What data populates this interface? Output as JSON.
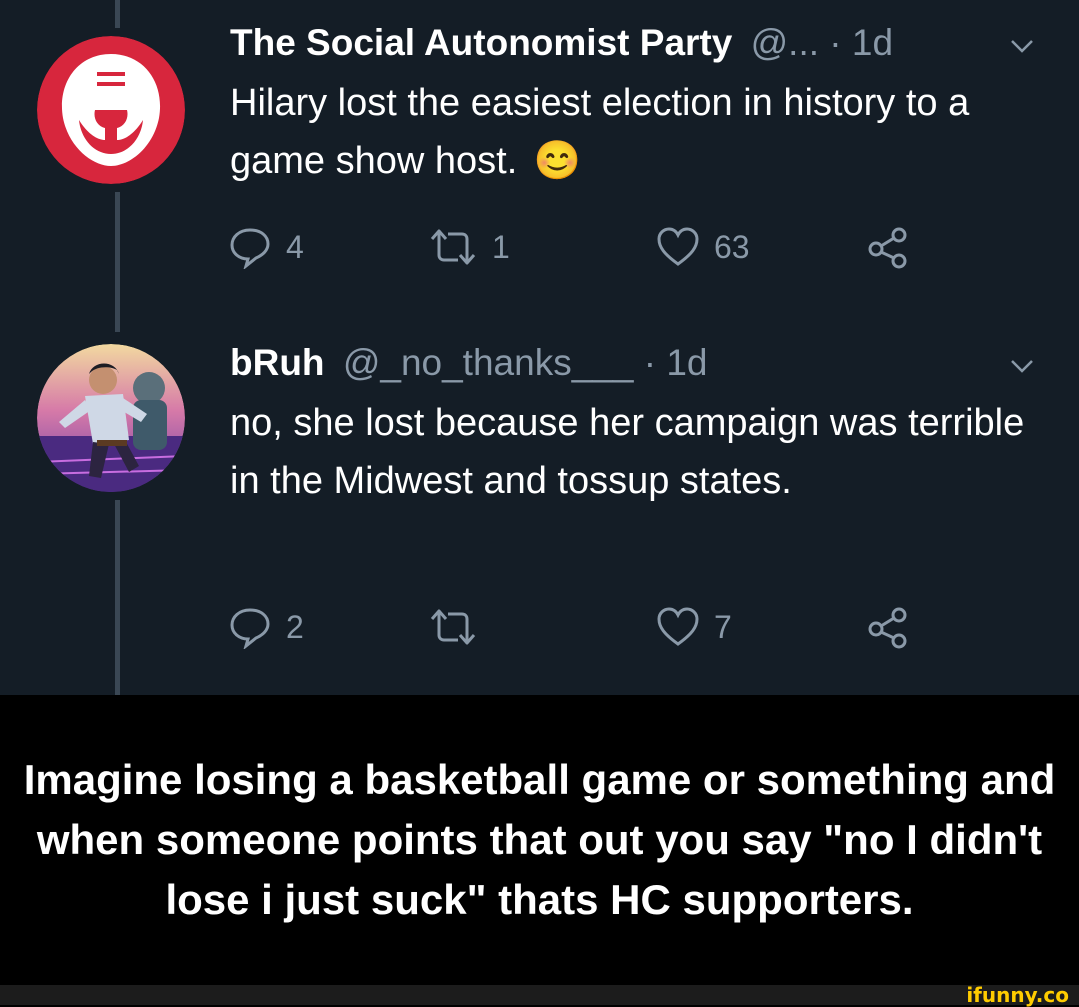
{
  "tweets": [
    {
      "name": "The Social Autonomist Party",
      "handle": "@...",
      "time": "1d",
      "separator": " · ",
      "text": "Hilary lost the easiest election in history to a game show host.",
      "emoji": "😊",
      "replies": "4",
      "retweets": "1",
      "likes": "63",
      "avatar_icon": "rebel-fist-icon",
      "avatar_color": "#d7263d"
    },
    {
      "name": "bRuh",
      "handle": "@_no_thanks___",
      "time": "1d",
      "separator": " · ",
      "text": "no, she lost because her campaign was terrible in the Midwest and tossup states.",
      "replies": "2",
      "retweets": "",
      "likes": "7",
      "avatar_icon": "illustrated-photo-avatar"
    }
  ],
  "caption": "Imagine losing a basketball game or something and when someone points that out you say \"no I didn't lose i just suck\" thats HC supporters.",
  "watermark": "ifunny.co",
  "colors": {
    "background": "#141d26",
    "muted": "#8a99a8",
    "text": "#ffffff",
    "watermark": "#ffcc00"
  }
}
